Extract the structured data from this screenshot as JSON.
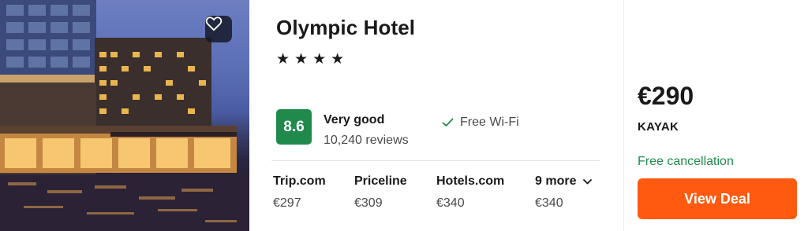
{
  "hotel": {
    "name": "Olympic Hotel",
    "stars_text": "★★★★",
    "star_count": 4
  },
  "rating": {
    "score": "8.6",
    "label": "Very good",
    "reviews": "10,240 reviews",
    "badge_color": "#1f8a4c"
  },
  "amenity": {
    "icon": "check-icon",
    "label": "Free Wi-Fi"
  },
  "providers": [
    {
      "name": "Trip.com",
      "price": "€297"
    },
    {
      "name": "Priceline",
      "price": "€309"
    },
    {
      "name": "Hotels.com",
      "price": "€340"
    }
  ],
  "more": {
    "label": "9 more",
    "price": "€340"
  },
  "deal": {
    "price": "€290",
    "site": "KAYAK",
    "cancellation": "Free cancellation",
    "button_label": "View Deal",
    "button_color": "#ff5a10"
  },
  "favorite": {
    "icon": "heart-icon"
  }
}
